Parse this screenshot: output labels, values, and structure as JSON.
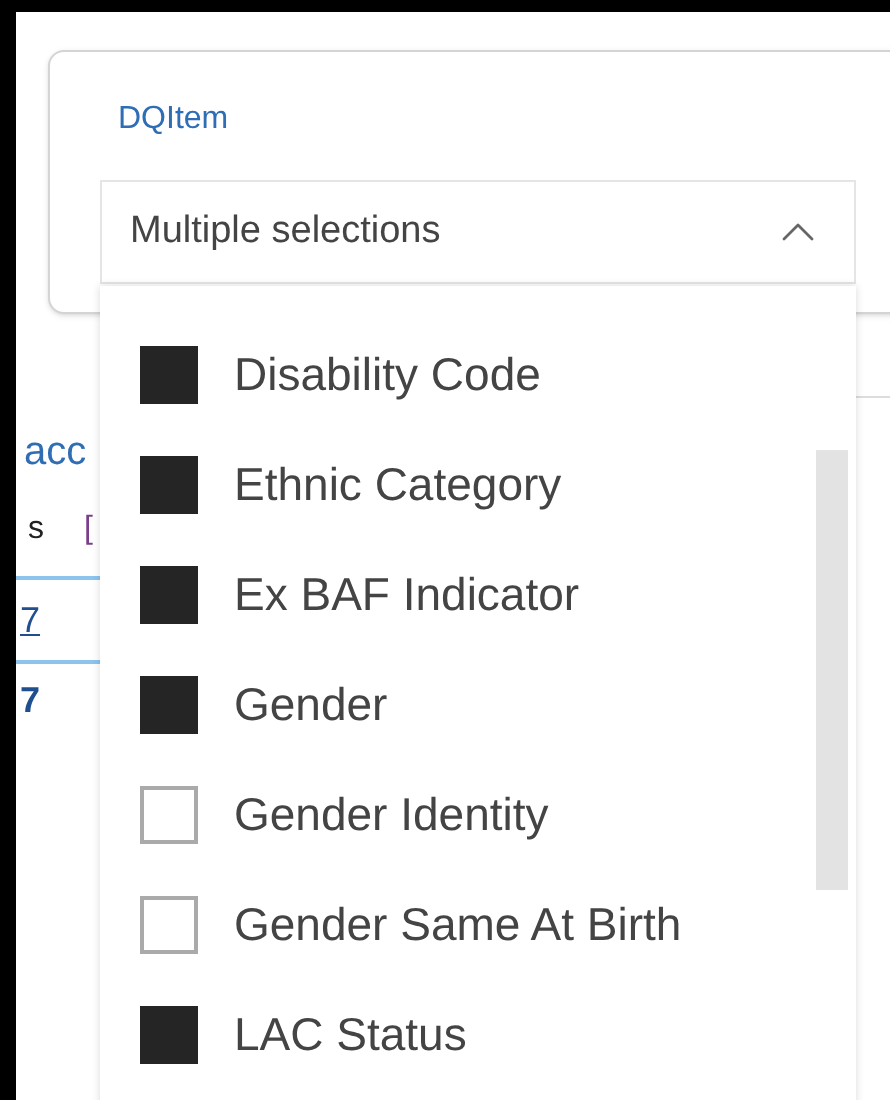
{
  "filter": {
    "label": "DQItem",
    "value": "Multiple selections",
    "expanded": true
  },
  "options": [
    {
      "label": "Disability Code",
      "checked": true
    },
    {
      "label": "Ethnic Category",
      "checked": true
    },
    {
      "label": "Ex BAF Indicator",
      "checked": true
    },
    {
      "label": "Gender",
      "checked": true
    },
    {
      "label": "Gender Identity",
      "checked": false
    },
    {
      "label": "Gender Same At Birth",
      "checked": false
    },
    {
      "label": "LAC Status",
      "checked": true
    }
  ],
  "background": {
    "heading": "acc",
    "row_label": "s",
    "row_mark": "[",
    "value_1": "7",
    "value_2": "7"
  }
}
